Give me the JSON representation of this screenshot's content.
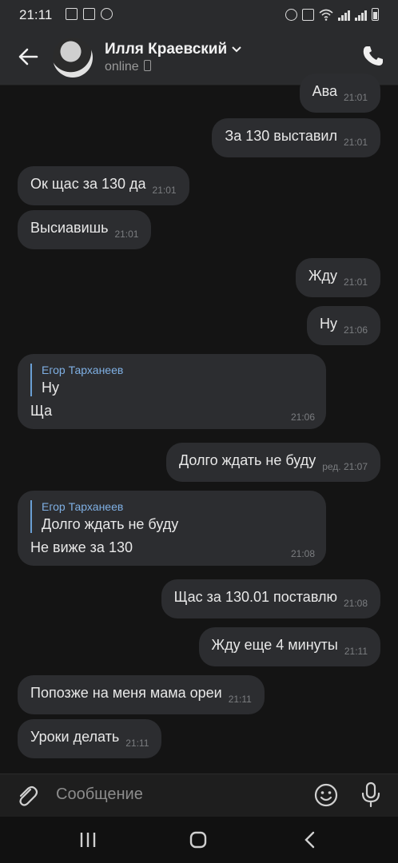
{
  "status_bar": {
    "time": "21:11"
  },
  "header": {
    "contact_name": "Илля Краевский",
    "status": "online"
  },
  "messages": [
    {
      "side": "out",
      "text": "Ава",
      "time": "21:01"
    },
    {
      "side": "out",
      "text": "За 130 выставил",
      "time": "21:01"
    },
    {
      "side": "in",
      "text": "Ок щас за 130 да",
      "time": "21:01"
    },
    {
      "side": "in",
      "text": "Высиавишь",
      "time": "21:01"
    },
    {
      "side": "out",
      "text": "Жду",
      "time": "21:01"
    },
    {
      "side": "out",
      "text": "Ну",
      "time": "21:06"
    },
    {
      "side": "in",
      "text": "Ща",
      "time": "21:06",
      "reply_name": "Егор Тарханеев",
      "reply_text": "Ну"
    },
    {
      "side": "out",
      "text": "Долго ждать не буду",
      "time": "ред. 21:07"
    },
    {
      "side": "in",
      "text": "Не виже за 130",
      "time": "21:08",
      "reply_name": "Егор Тарханеев",
      "reply_text": "Долго ждать не буду"
    },
    {
      "side": "out",
      "text": "Щас за 130.01 поставлю",
      "time": "21:08"
    },
    {
      "side": "out",
      "text": "Жду еще 4 минуты",
      "time": "21:11"
    },
    {
      "side": "in",
      "text": "Попозже на меня мама ореи",
      "time": "21:11"
    },
    {
      "side": "in",
      "text": "Уроки делать",
      "time": "21:11"
    }
  ],
  "composer": {
    "placeholder": "Сообщение"
  },
  "icons": {
    "back": "arrow-left-icon",
    "call": "phone-icon",
    "attach": "paperclip-icon",
    "emoji": "emoji-icon",
    "mic": "microphone-icon",
    "nav_recents": "recents-icon",
    "nav_home": "home-icon",
    "nav_back": "chevron-left-icon"
  },
  "colors": {
    "bubble": "#2c2d30",
    "background": "#141414",
    "reply_accent": "#6a9fd4"
  }
}
